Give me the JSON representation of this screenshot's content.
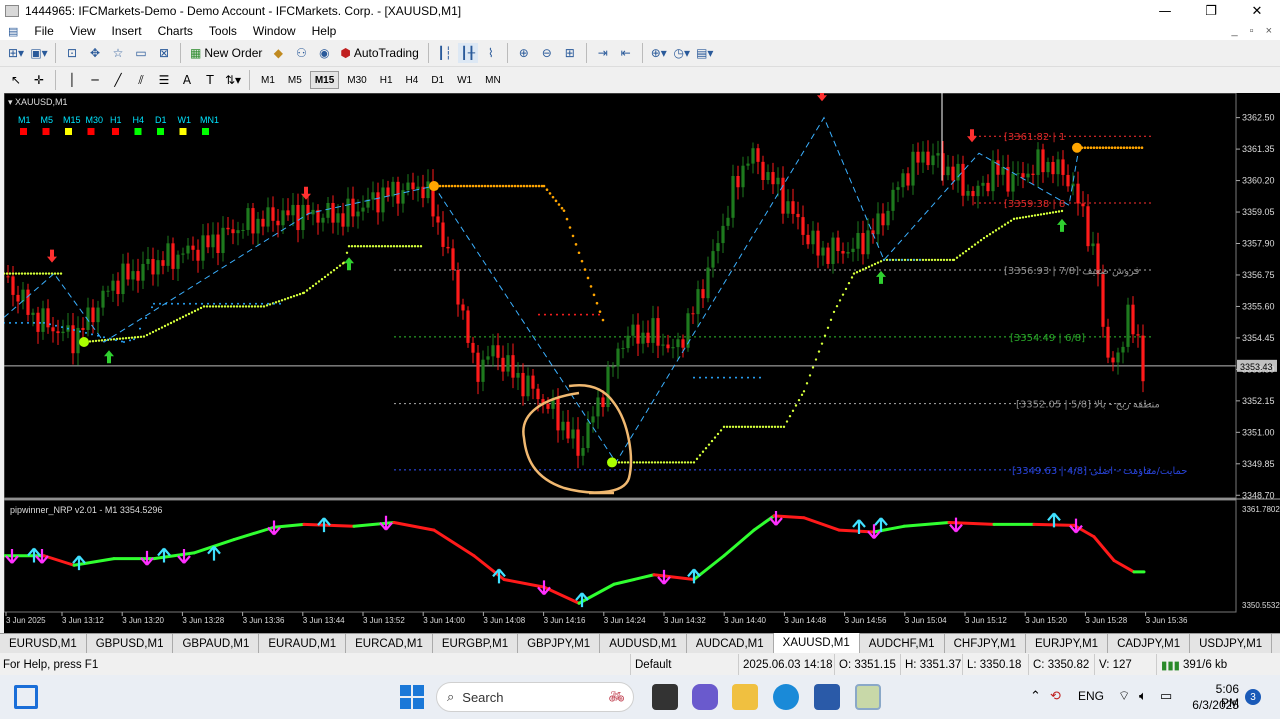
{
  "window": {
    "title": "1444965: IFCMarkets-Demo - Demo Account - IFCMarkets. Corp. - [XAUUSD,M1]",
    "min": "—",
    "max": "❐",
    "close": "✕"
  },
  "menu": [
    "File",
    "View",
    "Insert",
    "Charts",
    "Tools",
    "Window",
    "Help"
  ],
  "toolbar": {
    "new_order": "New Order",
    "autotrading": "AutoTrading"
  },
  "timeframes": [
    "M1",
    "M5",
    "M15",
    "M30",
    "H1",
    "H4",
    "D1",
    "W1",
    "MN"
  ],
  "active_timeframe": "M15",
  "chart": {
    "symbol_label": "XAUUSD,M1",
    "tf_indicators": [
      {
        "label": "M1",
        "color": "#ff0000"
      },
      {
        "label": "M5",
        "color": "#ff0000"
      },
      {
        "label": "M15",
        "color": "#ffff00"
      },
      {
        "label": "M30",
        "color": "#ff0000"
      },
      {
        "label": "H1",
        "color": "#ff0000"
      },
      {
        "label": "H4",
        "color": "#00ff00"
      },
      {
        "label": "D1",
        "color": "#00ff00"
      },
      {
        "label": "W1",
        "color": "#ffff00"
      },
      {
        "label": "MN1",
        "color": "#00ff00"
      }
    ],
    "price_labels": [
      "3362.50",
      "3361.35",
      "3360.20",
      "3359.05",
      "3357.90",
      "3356.75",
      "3355.60",
      "3354.45",
      "3353.30",
      "3352.15",
      "3351.00",
      "3349.85",
      "3348.70"
    ],
    "current_price": "3353.43",
    "level_texts": [
      "[3361.82 | 1",
      "[3359.38 | 8",
      "[3356.93 | 7/8] فروش ضعیف",
      "[3354.49 | 6/8]",
      "[3352.05 | 5/8] منطقه ربح - بالا",
      "[3349.63 | 4/8] حمایت/مقاومت - اصلی"
    ],
    "sub_label": "pipwinner_NRP v2.01 - M1 3354.5296",
    "sub_scale": [
      "3361.7802",
      "3350.5532"
    ],
    "time_labels": [
      "3 Jun 2025",
      "3 Jun 13:12",
      "3 Jun 13:20",
      "3 Jun 13:28",
      "3 Jun 13:36",
      "3 Jun 13:44",
      "3 Jun 13:52",
      "3 Jun 14:00",
      "3 Jun 14:08",
      "3 Jun 14:16",
      "3 Jun 14:24",
      "3 Jun 14:32",
      "3 Jun 14:40",
      "3 Jun 14:48",
      "3 Jun 14:56",
      "3 Jun 15:04",
      "3 Jun 15:12",
      "3 Jun 15:20",
      "3 Jun 15:28",
      "3 Jun 15:36"
    ],
    "colors": {
      "bull": "#1e7a1e",
      "bear": "#ff1a1a",
      "supertrend": "#d4ff3a",
      "orange": "#ffa500",
      "grid": "#555555"
    }
  },
  "tabs": [
    "EURUSD,M1",
    "GBPUSD,M1",
    "GBPAUD,M1",
    "EURAUD,M1",
    "EURCAD,M1",
    "EURGBP,M1",
    "GBPJPY,M1",
    "AUDUSD,M1",
    "AUDCAD,M1",
    "XAUUSD,M1",
    "AUDCHF,M1",
    "CHFJPY,M1",
    "EURJPY,M1",
    "CADJPY,M1",
    "USDJPY,M1",
    "GBP"
  ],
  "active_tab": "XAUUSD,M1",
  "status": {
    "help": "For Help, press F1",
    "profile": "Default",
    "datetime": "2025.06.03 14:18",
    "open": "O: 3351.15",
    "high": "H: 3351.37",
    "low": "L: 3350.18",
    "close": "C: 3350.82",
    "volume": "V: 127",
    "traffic": "391/6 kb"
  },
  "taskbar": {
    "search": "Search",
    "lang": "ENG",
    "time": "5:06 PM",
    "date": "6/3/2025",
    "badge": "3"
  }
}
